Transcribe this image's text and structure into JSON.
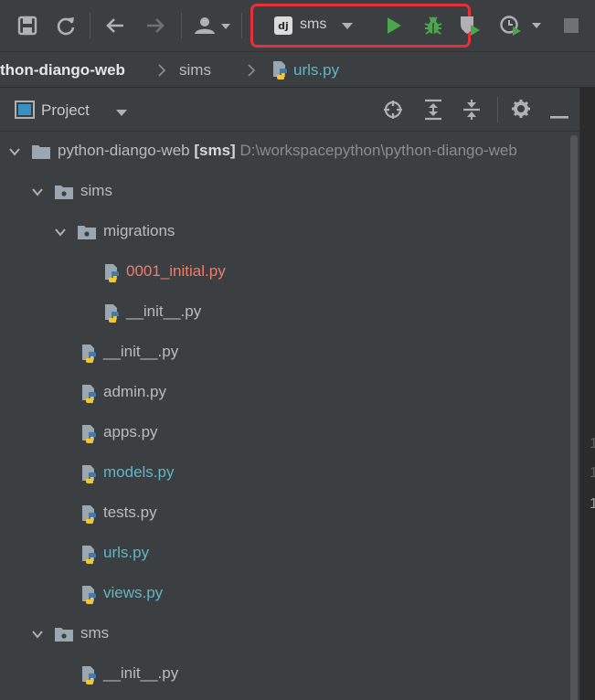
{
  "toolbar": {
    "icons": [
      "save-icon",
      "sync-icon",
      "back-icon",
      "forward-icon",
      "user-icon",
      "run-icon",
      "debug-icon",
      "coverage-icon",
      "profile-icon",
      "stop-icon"
    ],
    "run_config": {
      "badge": "dj",
      "label": "sms"
    },
    "colors": {
      "run": "#4ca64c",
      "debug": "#4ca64c",
      "highlight": "#e5303a"
    }
  },
  "breadcrumb": {
    "project": "thon-diango-web",
    "folder": "sims",
    "file": "urls.py"
  },
  "panel": {
    "title": "Project",
    "icons": [
      "locate-icon",
      "expand-all-icon",
      "collapse-all-icon",
      "gear-icon",
      "minimize-icon"
    ]
  },
  "tree": {
    "root": {
      "name": "python-diango-web",
      "module": "[sms]",
      "path": "D:\\workspacepython\\python-diango-web"
    },
    "items": [
      {
        "label": "sims"
      },
      {
        "label": "migrations"
      },
      {
        "label": "0001_initial.py"
      },
      {
        "label": "__init__.py"
      },
      {
        "label": "__init__.py"
      },
      {
        "label": "admin.py"
      },
      {
        "label": "apps.py"
      },
      {
        "label": "models.py"
      },
      {
        "label": "tests.py"
      },
      {
        "label": "urls.py"
      },
      {
        "label": "views.py"
      },
      {
        "label": "sms"
      },
      {
        "label": "__init__.py"
      }
    ]
  },
  "editor": {
    "gutter": [
      "1",
      "1",
      "1"
    ]
  }
}
